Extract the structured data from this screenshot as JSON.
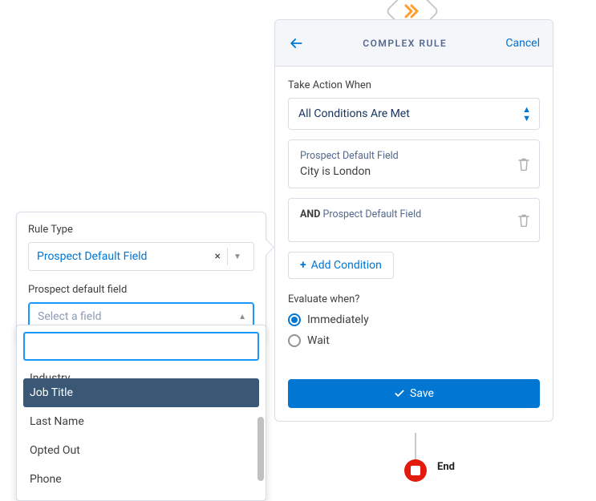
{
  "canvas": {
    "end_label": "End"
  },
  "panel": {
    "title": "COMPLEX RULE",
    "cancel": "Cancel",
    "take_action_label": "Take Action When",
    "take_action_value": "All Conditions Are Met",
    "conditions": [
      {
        "prefix": "Prospect Default Field",
        "and": false,
        "body": "City is London"
      },
      {
        "prefix": "Prospect Default Field",
        "and": true,
        "body": ""
      }
    ],
    "add_condition": "Add Condition",
    "evaluate_label": "Evaluate when?",
    "evaluate_options": {
      "immediately": "Immediately",
      "wait": "Wait"
    },
    "evaluate_selected": "immediately",
    "save": "Save"
  },
  "popover": {
    "rule_type_label": "Rule Type",
    "rule_type_value": "Prospect Default Field",
    "field_label": "Prospect default field",
    "field_placeholder": "Select a field"
  },
  "dropdown": {
    "search_value": "",
    "partial_top": "Industry",
    "items": [
      {
        "label": "Job Title",
        "highlight": true
      },
      {
        "label": "Last Name",
        "highlight": false
      },
      {
        "label": "Opted Out",
        "highlight": false
      },
      {
        "label": "Phone",
        "highlight": false
      }
    ]
  },
  "icons": {
    "chevrons_color": "#ff9e2c"
  }
}
